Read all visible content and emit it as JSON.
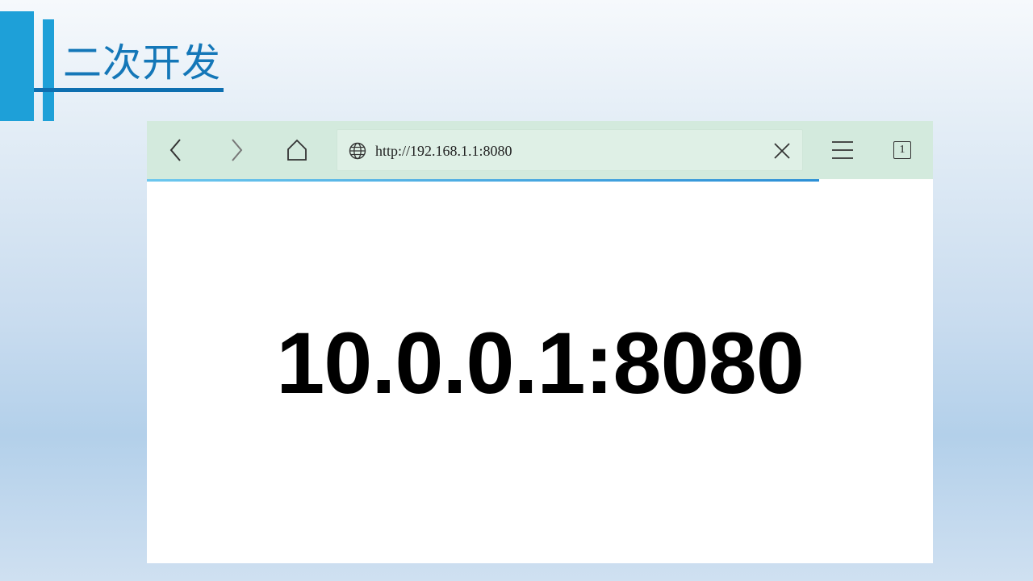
{
  "slide": {
    "title": "二次开发"
  },
  "browser": {
    "toolbar": {
      "back_icon": "chevron-left-icon",
      "forward_icon": "chevron-right-icon",
      "home_icon": "home-icon",
      "menu_icon": "hamburger-menu-icon",
      "tabs_count": "1"
    },
    "address_bar": {
      "icon": "globe-icon",
      "url": "http://192.168.1.1:8080",
      "clear_icon": "close-icon"
    },
    "page_load_progress": 0.855,
    "content": {
      "display_text": "10.0.0.1:8080"
    }
  },
  "colors": {
    "accent": "#1ea0d8",
    "title": "#1477b8",
    "toolbar_bg": "#d3eadd",
    "progress": "#2c8fd6"
  }
}
